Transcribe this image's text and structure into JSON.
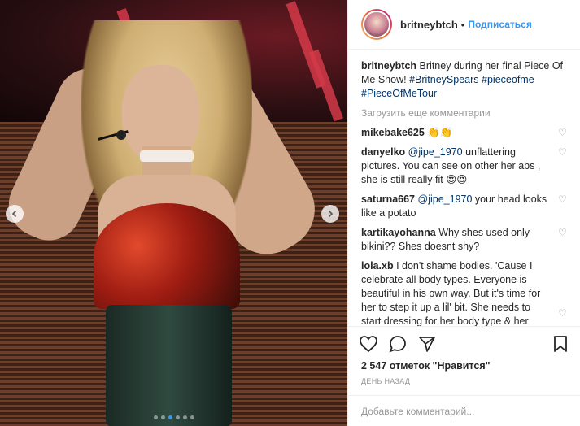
{
  "post": {
    "author": "britneybtch",
    "separator": "•",
    "follow_label": "Подписаться",
    "caption_text": "Britney during her final Piece Of Me Show!",
    "hashtags": [
      "#BritneySpears",
      "#pieceofme",
      "#PieceOfMeTour"
    ],
    "load_more_label": "Загрузить еще комментарии",
    "comments": [
      {
        "user": "mikebake625",
        "text": "👏👏"
      },
      {
        "user": "danyelko",
        "mention": "@jipe_1970",
        "text": "unflattering pictures. You can see on other her abs , she is still really fit 😍😍"
      },
      {
        "user": "saturna667",
        "mention": "@jipe_1970",
        "text": "your head looks like a potato"
      },
      {
        "user": "kartikayohanna",
        "text": "Why shes used only bikini?? Shes doesnt shy?"
      },
      {
        "user": "lola.xb",
        "text": "I don't shame bodies. 'Cause I celebrate all body types. Everyone is beautiful in his own way. But it's time for her to step it up a lil' bit. She needs to start dressing for her body type & her age. Hire a new glam squad. She is"
      }
    ],
    "likes_text": "2 547 отметок \"Нравится\"",
    "date_text": "ДЕНЬ НАЗАД",
    "comment_placeholder": "Добавьте комментарий...",
    "carousel": {
      "count": 6,
      "active_index": 2
    },
    "icons": {
      "nav_prev": "chevron-left-icon",
      "nav_next": "chevron-right-icon",
      "like": "heart-icon",
      "comment": "comment-icon",
      "share": "share-icon",
      "save": "bookmark-icon"
    },
    "colors": {
      "link": "#3897f0",
      "hashtag": "#003569",
      "muted": "#999999",
      "text": "#262626"
    }
  }
}
